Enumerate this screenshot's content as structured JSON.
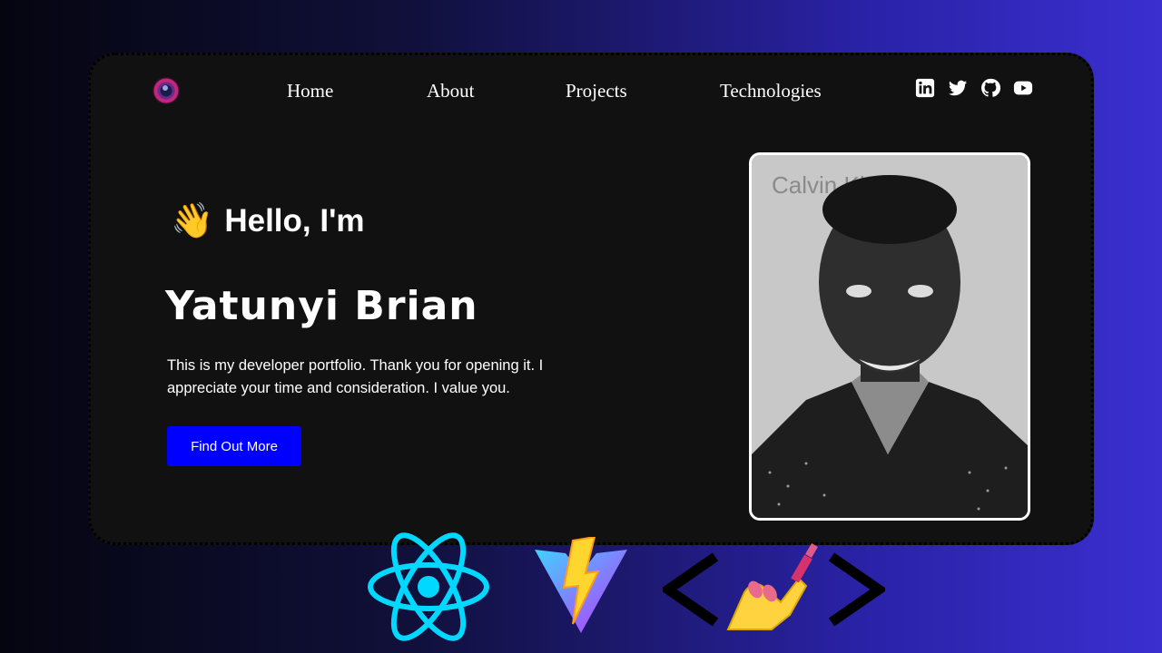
{
  "nav": {
    "logo_icon": "camera-lens-logo",
    "links": [
      "Home",
      "About",
      "Projects",
      "Technologies"
    ]
  },
  "social": [
    "linkedin-icon",
    "twitter-icon",
    "github-icon",
    "youtube-icon"
  ],
  "hero": {
    "greeting_emoji": "👋",
    "greeting": "Hello, I'm",
    "name": "Yatunyi Brian",
    "intro": "This is my developer portfolio. Thank you for opening it. I appreciate your time and consideration. I value you.",
    "cta_label": "Find Out More",
    "photo_text": "Calvin Kl"
  },
  "tech_logos": [
    "react-logo",
    "vite-logo",
    "styled-components-logo"
  ],
  "colors": {
    "card_bg": "#111111",
    "cta_bg": "#0000ff",
    "react": "#00d8ff",
    "vite_purple": "#8e4bff",
    "vite_bolt": "#ffd62e"
  }
}
